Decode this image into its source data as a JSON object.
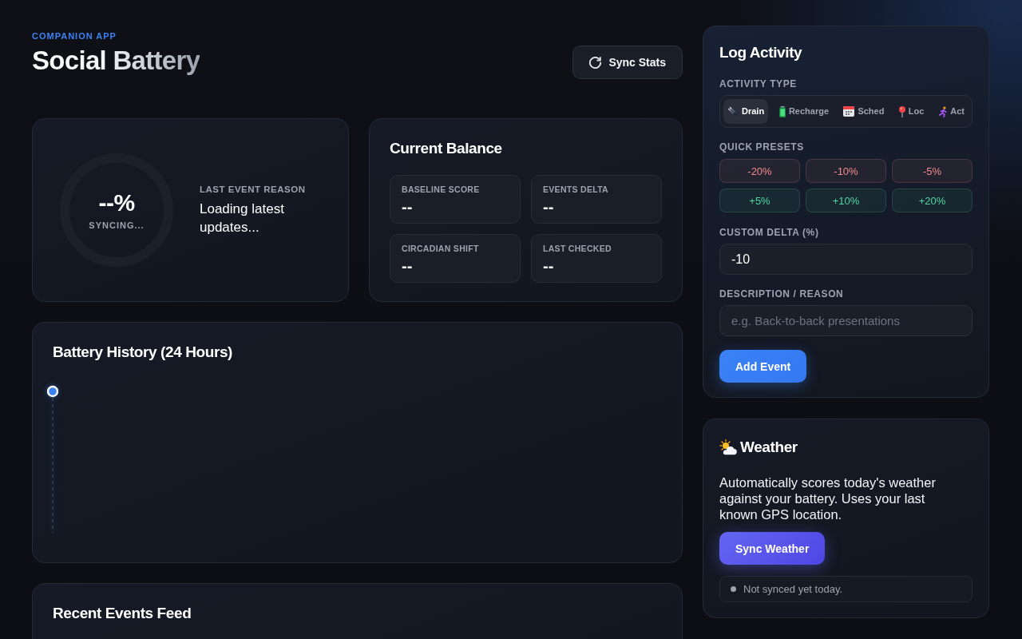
{
  "header": {
    "eyebrow": "COMPANION APP",
    "title": "Social Battery",
    "sync_button": "Sync Stats"
  },
  "battery": {
    "reading": "--%",
    "status": "SYNCING...",
    "reason_label": "LAST EVENT REASON",
    "reason": "Loading latest updates..."
  },
  "balance": {
    "title": "Current Balance",
    "stats": [
      {
        "label": "BASELINE SCORE",
        "value": "--"
      },
      {
        "label": "EVENTS DELTA",
        "value": "--"
      },
      {
        "label": "CIRCADIAN SHIFT",
        "value": "--"
      },
      {
        "label": "LAST CHECKED",
        "value": "--"
      }
    ]
  },
  "history": {
    "title": "Battery History (24 Hours)"
  },
  "feed": {
    "title": "Recent Events Feed"
  },
  "log_activity": {
    "title": "Log Activity",
    "type_label": "ACTIVITY TYPE",
    "types": [
      {
        "label": "Drain",
        "selected": true
      },
      {
        "label": "Recharge",
        "selected": false
      },
      {
        "label": "Sched",
        "selected": false
      },
      {
        "label": "Loc",
        "selected": false
      },
      {
        "label": "Act",
        "selected": false
      }
    ],
    "presets_label": "QUICK PRESETS",
    "presets": [
      {
        "label": "-20%",
        "color": "#f58b8b"
      },
      {
        "label": "-10%",
        "color": "#f58b8b"
      },
      {
        "label": "-5%",
        "color": "#f58b8b"
      },
      {
        "label": "+5%",
        "color": "#4fd6a0"
      },
      {
        "label": "+10%",
        "color": "#4fd6a0"
      },
      {
        "label": "+20%",
        "color": "#4fd6a0"
      }
    ],
    "custom_delta": {
      "label": "CUSTOM DELTA (%)",
      "value": "-10"
    },
    "description": {
      "label": "DESCRIPTION / REASON",
      "placeholder": "e.g. Back-to-back presentations"
    },
    "submit_button": "Add Event"
  },
  "weather": {
    "title": "Weather",
    "description": "Automatically scores today's weather against your battery. Uses your last known GPS location.",
    "button": "Sync Weather",
    "status": "Not synced yet today."
  }
}
